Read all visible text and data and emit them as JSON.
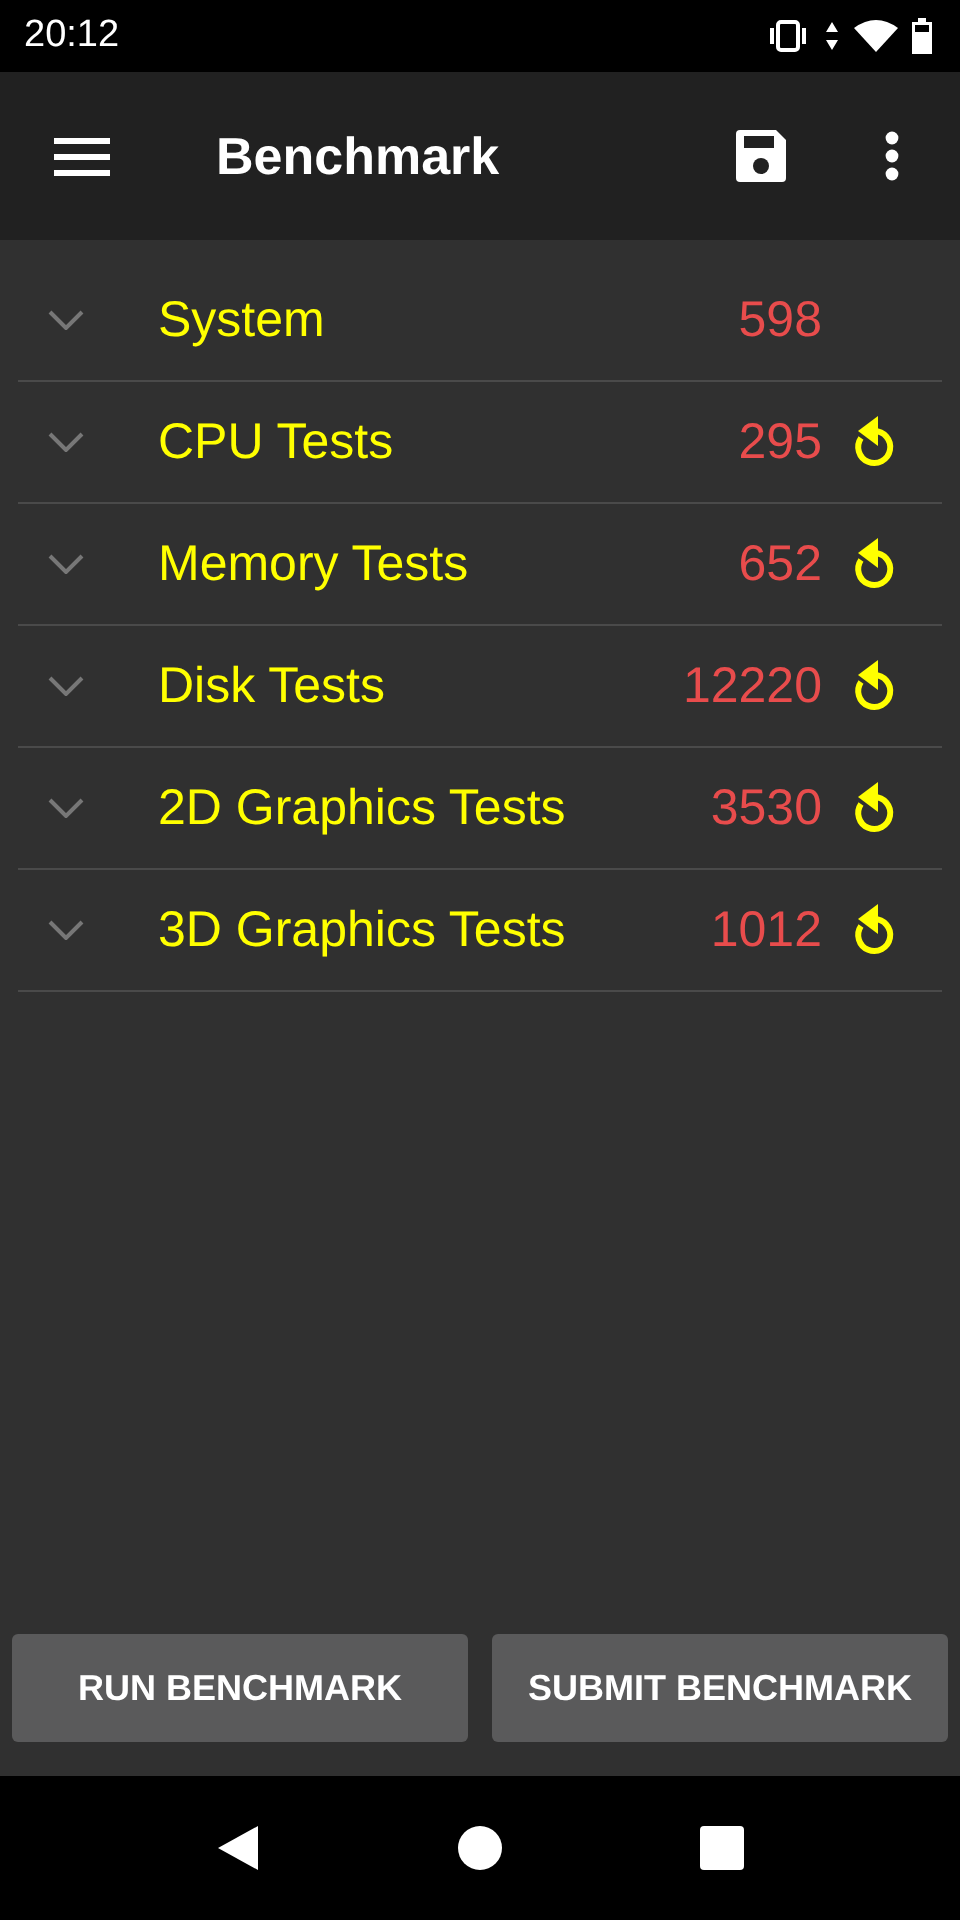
{
  "status_bar": {
    "time": "20:12"
  },
  "toolbar": {
    "title": "Benchmark"
  },
  "sections": [
    {
      "label": "System",
      "score": "598",
      "expanded": false,
      "rerun": false
    },
    {
      "label": "CPU Tests",
      "score": "295",
      "expanded": false,
      "rerun": true
    },
    {
      "label": "Memory Tests",
      "score": "652",
      "expanded": false,
      "rerun": true
    },
    {
      "label": "Disk Tests",
      "score": "12220",
      "expanded": false,
      "rerun": true
    },
    {
      "label": "2D Graphics Tests",
      "score": "3530",
      "expanded": false,
      "rerun": true
    },
    {
      "label": "3D Graphics Tests",
      "score": "1012",
      "expanded": false,
      "rerun": true
    }
  ],
  "buttons": [
    "RUN BENCHMARK",
    "SUBMIT BENCHMARK"
  ]
}
